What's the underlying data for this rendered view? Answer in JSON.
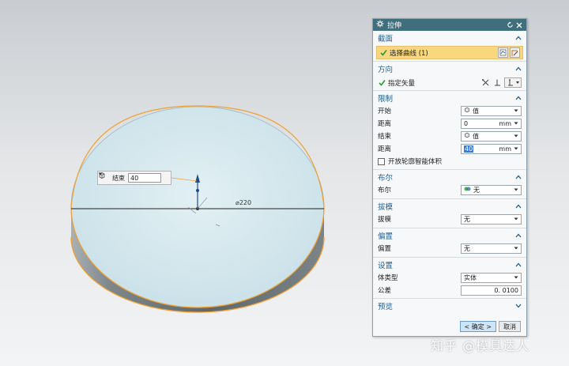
{
  "viewport": {
    "dimension_label": "⌀220",
    "mini_toolbar": {
      "limit_label": "结束",
      "limit_value": "40"
    }
  },
  "dialog": {
    "title": "拉伸",
    "sections": {
      "section_profile": {
        "label": "截面",
        "select_curve": "选择曲线 (1)"
      },
      "section_direction": {
        "label": "方向",
        "specify_vector": "指定矢量"
      },
      "section_limits": {
        "label": "限制",
        "start_label": "开始",
        "start_option": "值",
        "start_distance_label": "距离",
        "start_distance": "0",
        "start_unit": "mm",
        "end_label": "结束",
        "end_option": "值",
        "end_distance_label": "距离",
        "end_distance": "40",
        "end_unit": "mm",
        "open_profile": "开放轮廓智能体积"
      },
      "section_boolean": {
        "label": "布尔",
        "row_label": "布尔",
        "value": "无"
      },
      "section_draft": {
        "label": "拔模",
        "row_label": "拔模",
        "value": "无"
      },
      "section_offset": {
        "label": "偏置",
        "row_label": "偏置",
        "value": "无"
      },
      "section_settings": {
        "label": "设置",
        "body_type_label": "体类型",
        "body_type": "实体",
        "tolerance_label": "公差",
        "tolerance": "0. 0100"
      },
      "section_preview": {
        "label": "预览"
      }
    },
    "ok_label": "< 确定 >",
    "cancel_label": "取消"
  },
  "watermark": "知乎 @模具达人",
  "colors": {
    "titlebar": "#3f6f7c",
    "section_header": "#1d5f95",
    "highlight": "#f9d77e",
    "edge_orange": "#f0a030",
    "top_face": "#d3e7ee",
    "side_face_dark": "#6b7478"
  },
  "icons": [
    "settings-icon",
    "reset-icon",
    "close-icon",
    "check-icon",
    "curve-select-icon",
    "sketch-icon",
    "vector-icon",
    "collapse-chevron-icon",
    "dropdown-arrow-icon",
    "value-icon",
    "boolean-none-icon"
  ]
}
